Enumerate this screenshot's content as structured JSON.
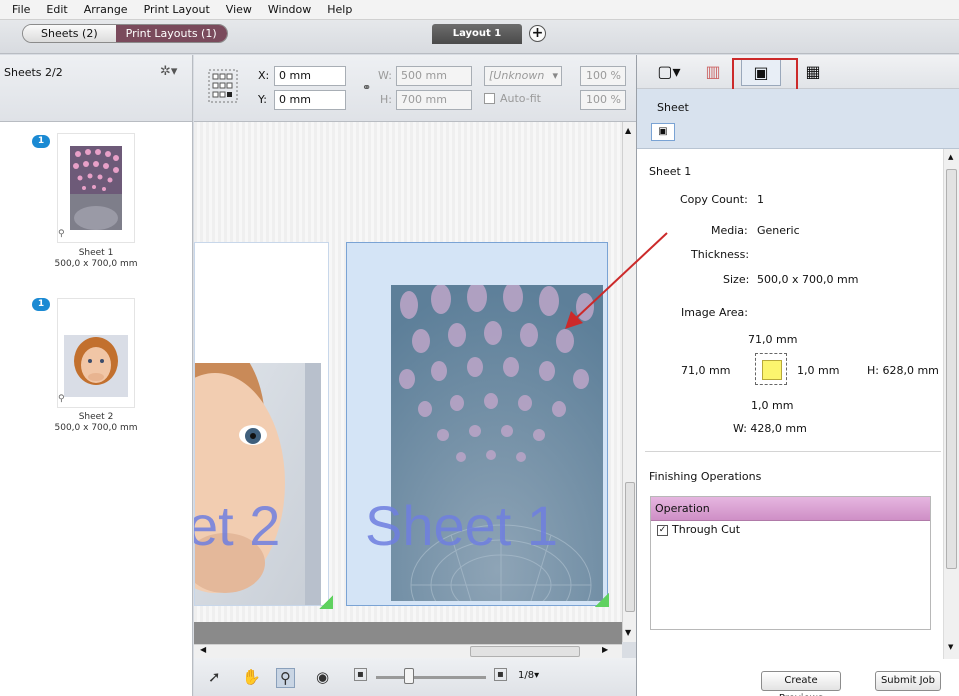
{
  "menu": [
    "File",
    "Edit",
    "Arrange",
    "Print Layout",
    "View",
    "Window",
    "Help"
  ],
  "tabs": {
    "sheets": "Sheets (2)",
    "print_layouts": "Print Layouts (1)",
    "layout": "Layout 1",
    "add": "+"
  },
  "left_panel": {
    "count": "Sheets 2/2",
    "gear": "✲▾",
    "sheets": [
      {
        "badge": "1",
        "name": "Sheet 1",
        "size": "500,0 x 700,0 mm"
      },
      {
        "badge": "1",
        "name": "Sheet 2",
        "size": "500,0 x 700,0 mm"
      }
    ]
  },
  "toolbar": {
    "x_label": "X:",
    "x_value": "0 mm",
    "y_label": "Y:",
    "y_value": "0 mm",
    "w_label": "W:",
    "w_value": "500 mm",
    "h_label": "H:",
    "h_value": "700 mm",
    "unknown": "[Unknown",
    "autofit": "Auto-fit",
    "pct1": "100 %",
    "pct2": "100 %"
  },
  "canvas": {
    "sheet2_label": "et 2",
    "sheet1_label": "Sheet 1"
  },
  "bottom_bar": {
    "page": "1/8▾",
    "create_previews": "Create Previews",
    "submit_job": "Submit Job"
  },
  "right_panel": {
    "sub_title": "Sheet",
    "sheet_name": "Sheet 1",
    "copy_count_label": "Copy Count:",
    "copy_count": "1",
    "media_label": "Media:",
    "media": "Generic",
    "thickness_label": "Thickness:",
    "size_label": "Size:",
    "size": "500,0 x 700,0 mm",
    "image_area_label": "Image Area:",
    "top": "71,0 mm",
    "left": "71,0 mm",
    "right": "1,0 mm",
    "height": "H: 628,0 mm",
    "bottom": "1,0 mm",
    "width": "W: 428,0 mm",
    "finishing_label": "Finishing Operations",
    "op_header": "Operation",
    "op_item": "Through Cut"
  },
  "colors": {
    "accent_tab": "#7a4a5c",
    "annotation": "#cc2a2a",
    "badge": "#1b8ad3",
    "op_header": "#d79ace"
  }
}
